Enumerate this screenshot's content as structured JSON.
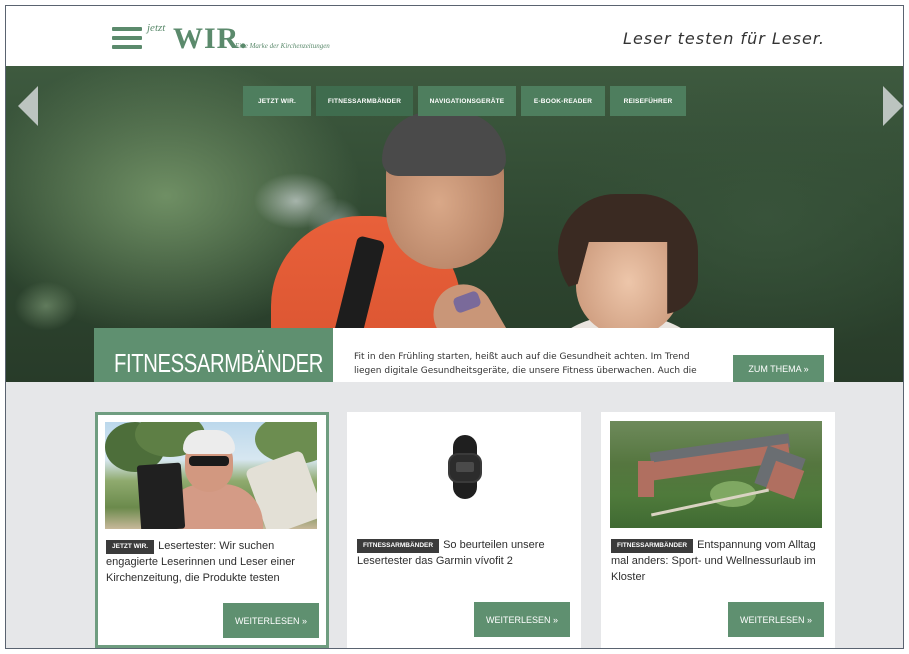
{
  "header": {
    "logo_small": "jetzt",
    "logo_big": "WIR.",
    "logo_sub": "Eine Marke der Kirchenzeitungen",
    "tagline": "Leser testen für Leser.",
    "brand_color": "#5b8a6c"
  },
  "nav": {
    "items": [
      {
        "label": "JETZT WIR."
      },
      {
        "label": "FITNESSARMBÄNDER"
      },
      {
        "label": "NAVIGATIONSGERÄTE"
      },
      {
        "label": "E-BOOK-READER"
      },
      {
        "label": "REISEFÜHRER"
      }
    ],
    "active": "FITNESSARMBÄNDER"
  },
  "feature": {
    "title": "FITNESSARMBÄNDER",
    "text": "Fit in den Frühling starten, heißt auch auf die Gesundheit achten. Im Trend liegen digitale Gesundheitsgeräte, die unsere Fitness überwachen. Auch die",
    "button": "ZUM THEMA »"
  },
  "cards": [
    {
      "badge": "JETZT WIR.",
      "text": "Lesertester: Wir suchen engagierte Leserinnen und Leser einer Kirchenzeitung, die Produkte testen",
      "button": "WEITERLESEN »",
      "image": "man-with-ebook-reader-photo"
    },
    {
      "badge": "FITNESSARMBÄNDER",
      "text": "So beurteilen unsere Lesertester das Garmin vívofit 2",
      "button": "WEITERLESEN »",
      "image": "fitness-band-photo"
    },
    {
      "badge": "FITNESSARMBÄNDER",
      "text": "Entspannung vom Alltag mal anders: Sport- und Wellnessurlaub im Kloster",
      "button": "WEITERLESEN »",
      "image": "cloister-aerial-photo"
    }
  ],
  "colors": {
    "accent_green": "#5f9070",
    "nav_green": "#4e7e5e",
    "badge_dark": "#3b3b3b",
    "page_bg": "#e6e7e9"
  }
}
